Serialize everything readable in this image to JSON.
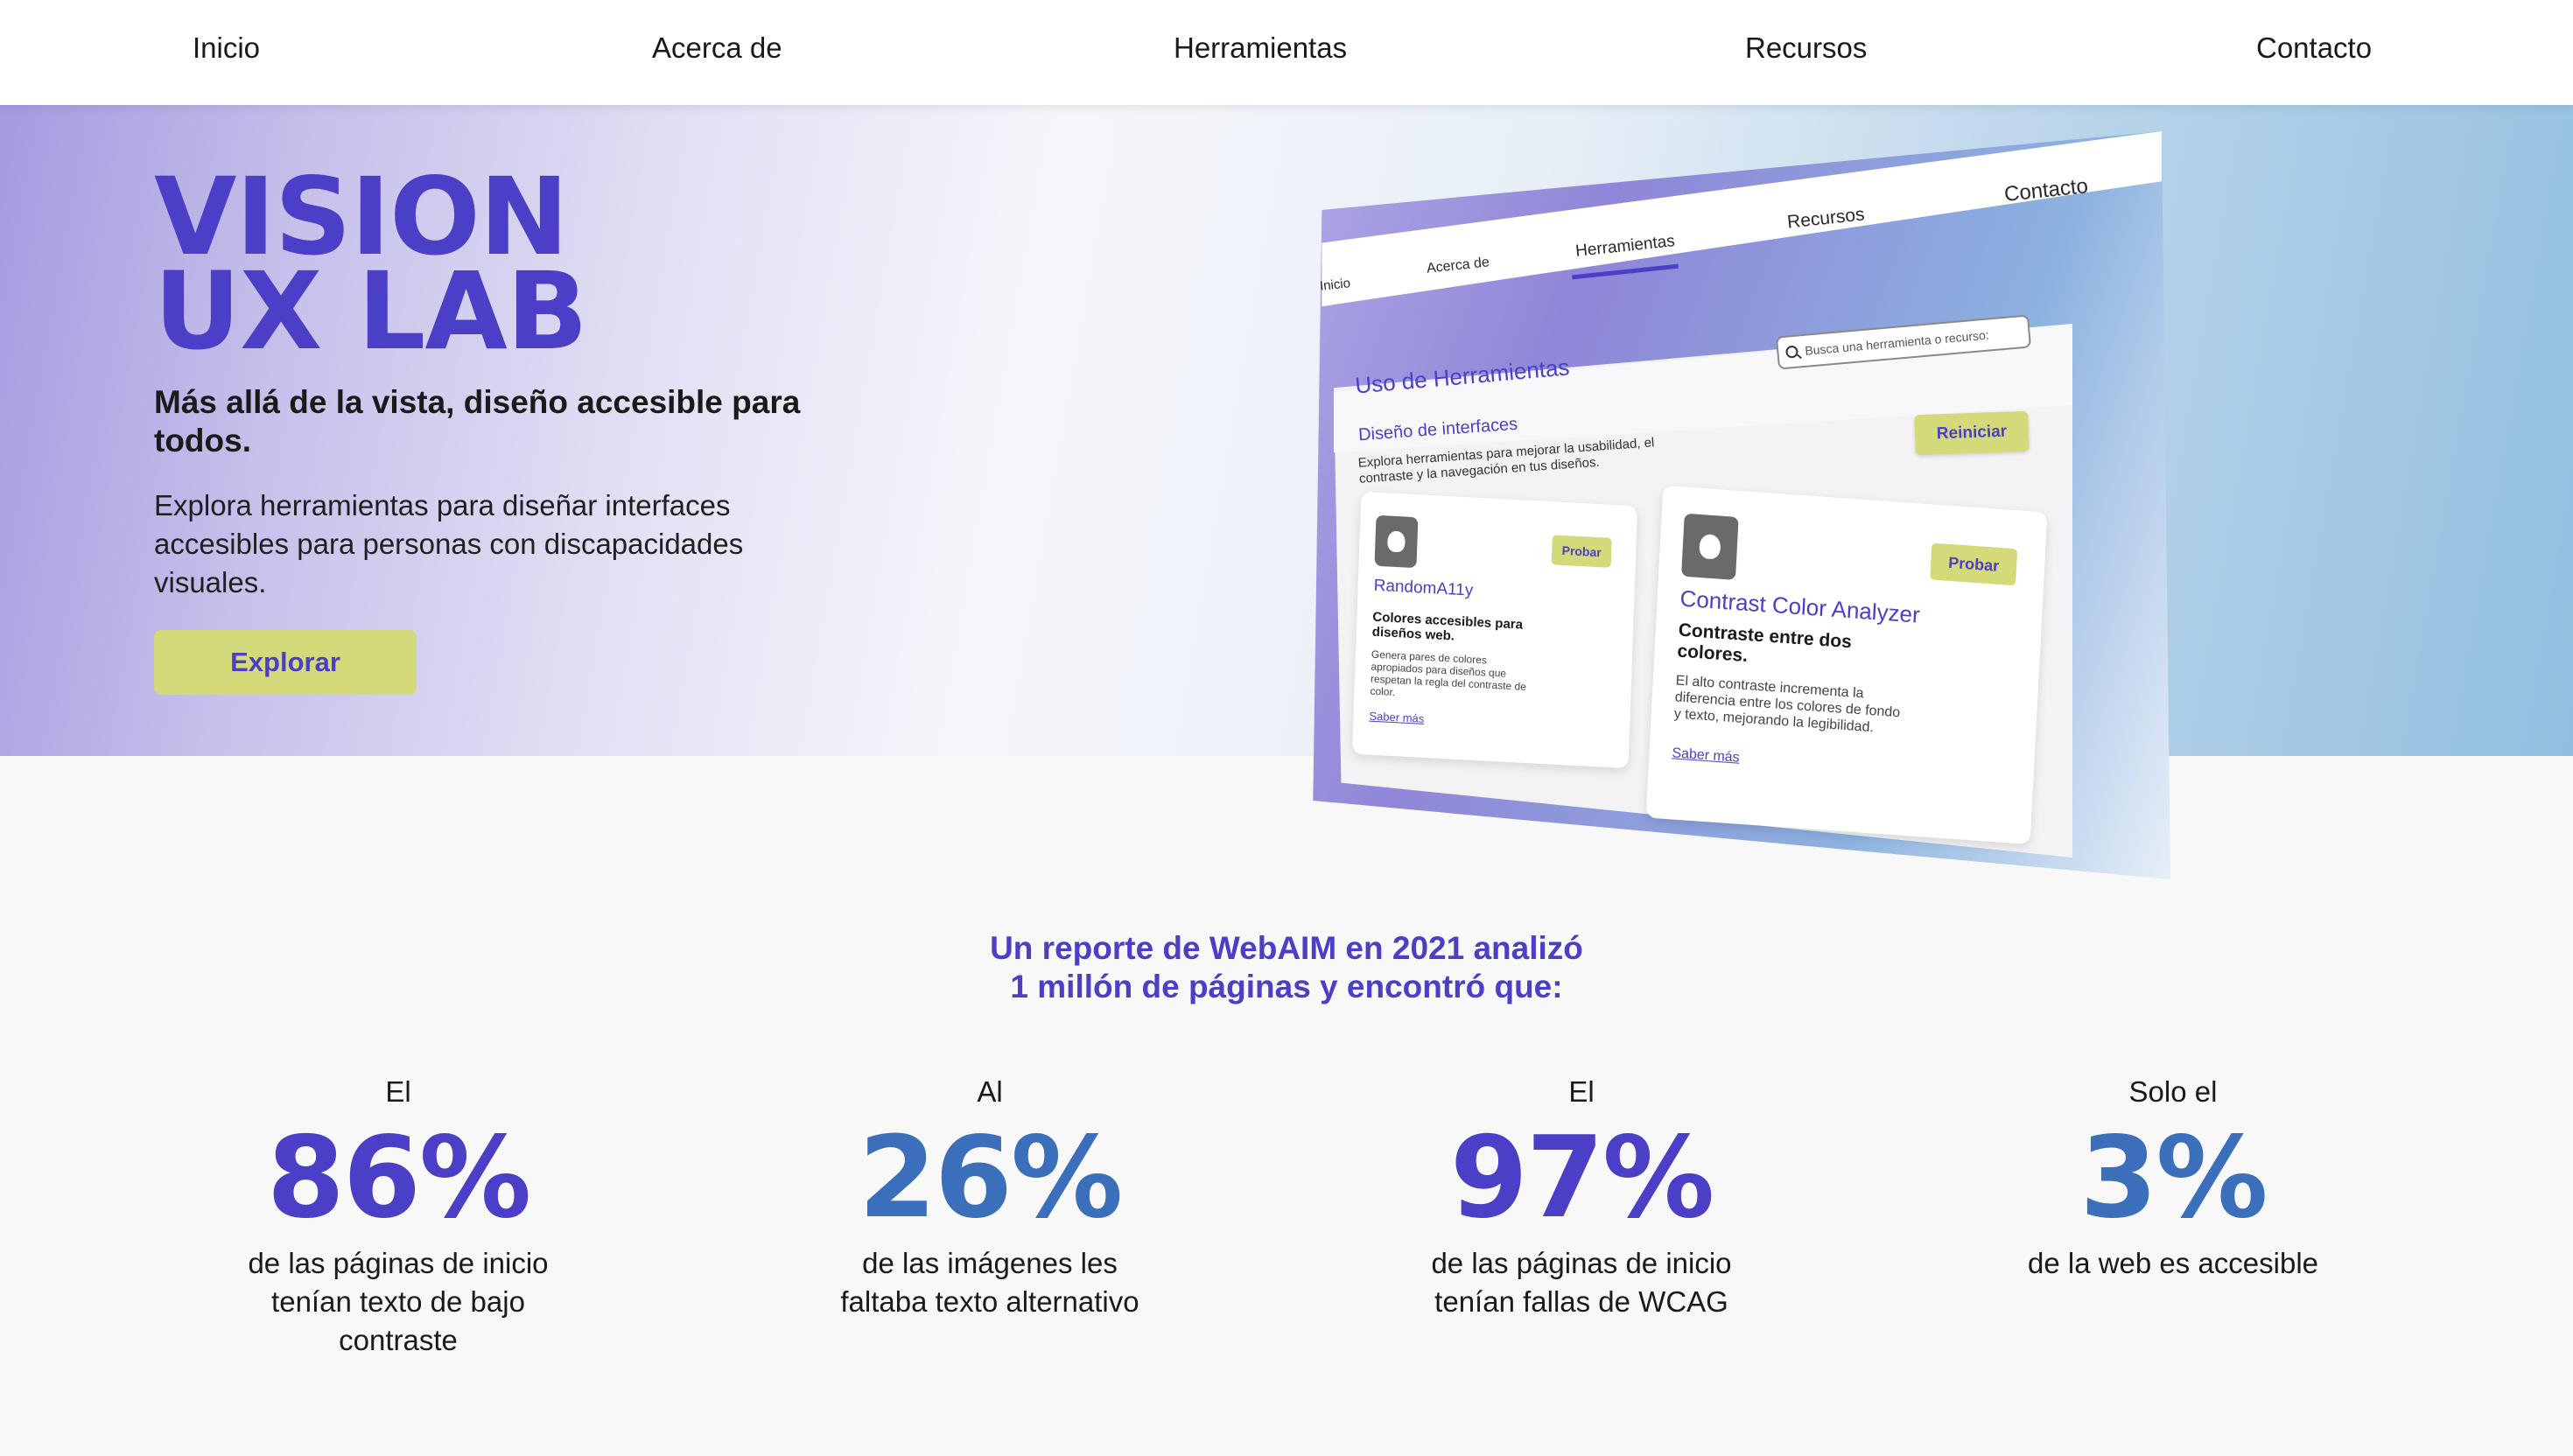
{
  "nav": {
    "items": [
      "Inicio",
      "Acerca de",
      "Herramientas",
      "Recursos",
      "Contacto"
    ]
  },
  "hero": {
    "title_line1": "VISION",
    "title_line2": "UX LAB",
    "subtitle": "Más allá de la vista, diseño accesible para todos.",
    "description": "Explora herramientas para diseñar interfaces accesibles para personas con discapacidades visuales.",
    "cta_label": "Explorar"
  },
  "mockup": {
    "nav": [
      "Inicio",
      "Acerca de",
      "Herramientas",
      "Recursos",
      "Contacto"
    ],
    "panel_title": "Uso de Herramientas",
    "search_placeholder": "Busca una herramienta o recurso:",
    "section_title": "Diseño de interfaces",
    "section_desc": "Explora herramientas para mejorar la usabilidad, el contraste y la navegación en tus diseños.",
    "reset_label": "Reiniciar",
    "cards": [
      {
        "icon": "palette-icon",
        "name": "RandomA11y",
        "try_label": "Probar",
        "headline": "Colores accesibles para diseños web.",
        "body": "Genera pares de colores apropiados para diseños que respetan la regla del contraste de color.",
        "link": "Saber más"
      },
      {
        "icon": "drop-icon",
        "name": "Contrast Color Analyzer",
        "try_label": "Probar",
        "headline": "Contraste entre dos colores.",
        "body": "El alto contraste incrementa la diferencia entre los colores de fondo y texto, mejorando la legibilidad.",
        "link": "Saber más"
      }
    ]
  },
  "stats": {
    "intro_line1": "Un reporte de WebAIM en 2021 analizó",
    "intro_line2": "1 millón de páginas y encontró que:",
    "items": [
      {
        "prefix": "El",
        "value": "86%",
        "desc": "de las páginas de inicio tenían texto de bajo contraste",
        "color": "#4a3fc6"
      },
      {
        "prefix": "Al",
        "value": "26%",
        "desc": "de las imágenes les faltaba texto alternativo",
        "color": "#3b6fbb"
      },
      {
        "prefix": "El",
        "value": "97%",
        "desc": "de las páginas de inicio tenían fallas de WCAG",
        "color": "#4a3fc6"
      },
      {
        "prefix": "Solo el",
        "value": "3%",
        "desc": "de la web es accesible",
        "color": "#3b6fbb"
      }
    ]
  },
  "colors": {
    "brand_purple": "#4a3fc6",
    "brand_blue": "#3b6fbb",
    "button_yellow": "#d4d97a"
  }
}
